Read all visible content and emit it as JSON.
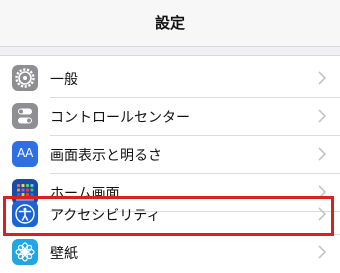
{
  "header": {
    "title": "設定"
  },
  "settings": {
    "items": [
      {
        "label": "一般",
        "icon": "gear-icon",
        "icon_bg": "#8e8e93"
      },
      {
        "label": "コントロールセンター",
        "icon": "toggles-icon",
        "icon_bg": "#8e8e93"
      },
      {
        "label": "画面表示と明るさ",
        "icon": "display-text-size-icon",
        "icon_bg": "#2f6fe4"
      },
      {
        "label": "ホーム画面",
        "icon": "home-screen-grid-icon",
        "icon_bg": "#1b4ba8"
      },
      {
        "label": "アクセシビリティ",
        "icon": "accessibility-icon",
        "icon_bg": "#1e63d6"
      },
      {
        "label": "壁紙",
        "icon": "wallpaper-flower-icon",
        "icon_bg": "#21a5e3"
      }
    ],
    "highlighted_item": "アクセシビリティ",
    "highlight_color": "#d9211f"
  },
  "icon_text": {
    "display": "AA"
  }
}
